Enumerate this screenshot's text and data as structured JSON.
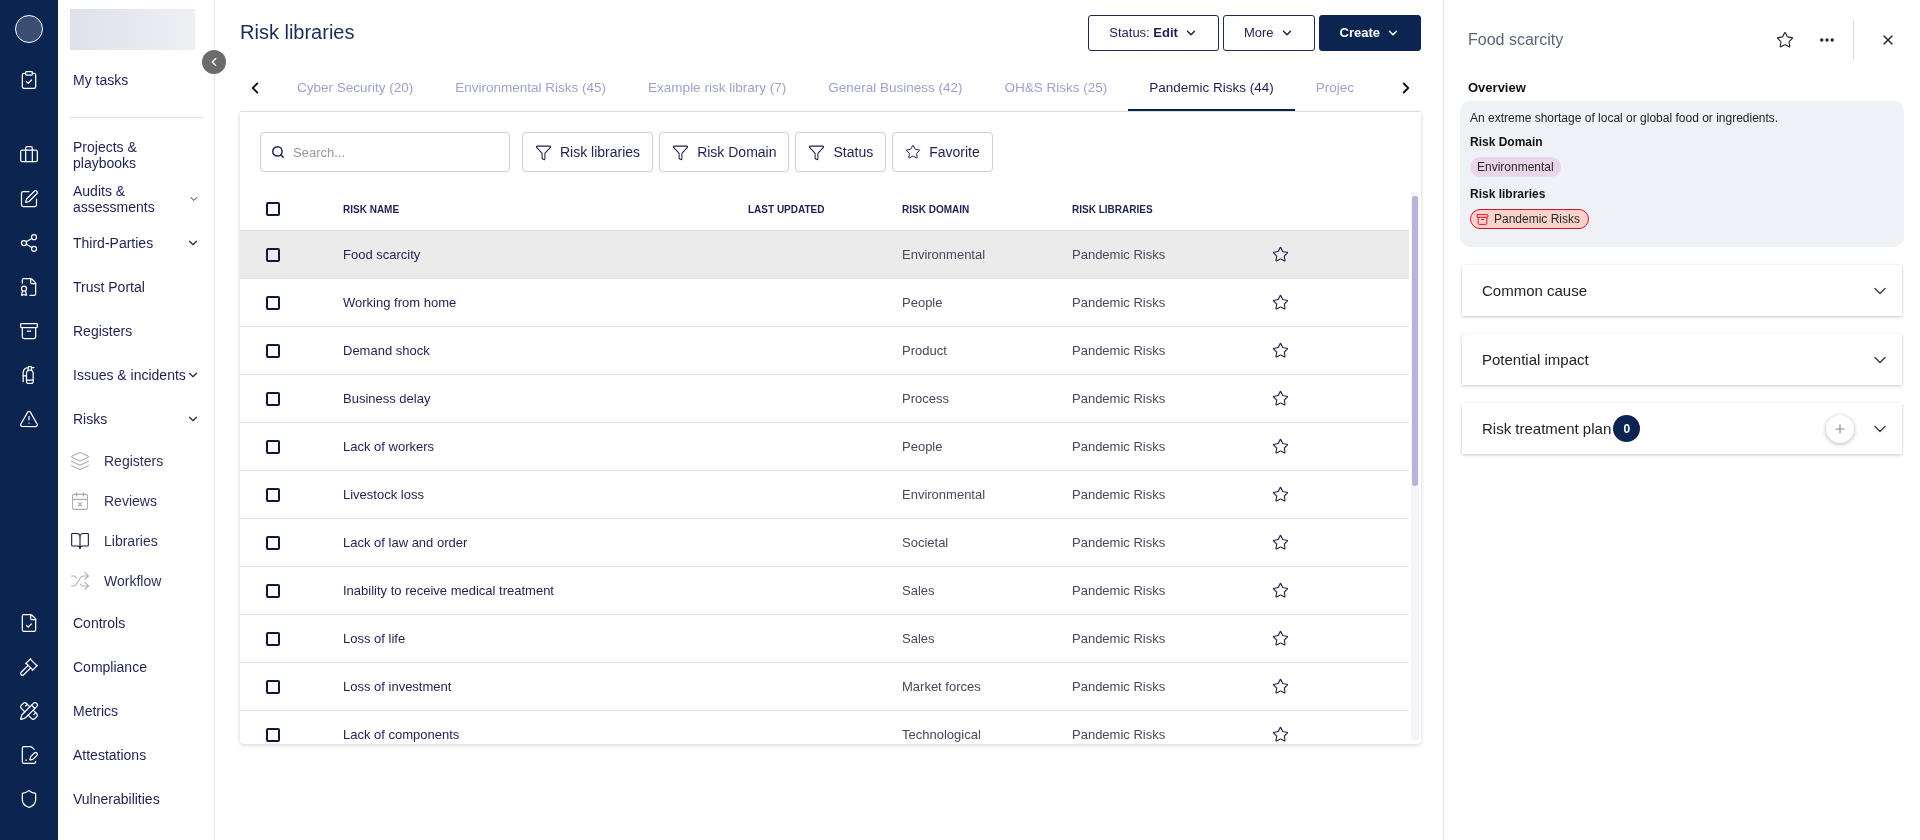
{
  "nav": {
    "top_items": [
      {
        "label": "My tasks"
      }
    ],
    "items": [
      {
        "label": "Projects & playbooks",
        "has_menu": false
      },
      {
        "label": "Audits & assessments",
        "has_menu": true
      },
      {
        "label": "Third-Parties",
        "has_menu": true
      },
      {
        "label": "Trust Portal",
        "has_menu": false
      },
      {
        "label": "Registers",
        "has_menu": false
      },
      {
        "label": "Issues & incidents",
        "has_menu": true
      },
      {
        "label": "Risks",
        "has_menu": true,
        "children": [
          {
            "label": "Registers",
            "selected": false
          },
          {
            "label": "Reviews",
            "selected": false
          },
          {
            "label": "Libraries",
            "selected": true
          },
          {
            "label": "Workflow",
            "selected": false
          }
        ]
      },
      {
        "label": "Controls",
        "has_menu": false
      },
      {
        "label": "Compliance",
        "has_menu": false
      },
      {
        "label": "Metrics",
        "has_menu": false
      },
      {
        "label": "Attestations",
        "has_menu": false
      },
      {
        "label": "Vulnerabilities",
        "has_menu": false
      }
    ]
  },
  "page": {
    "title": "Risk libraries",
    "buttons": [
      {
        "label": "Status: **Edit**",
        "kind": "outline"
      },
      {
        "label": "More",
        "kind": "outline"
      },
      {
        "label": "Create",
        "kind": "primary"
      }
    ]
  },
  "tabs": [
    {
      "label": "Cyber Security (20)",
      "selected": false
    },
    {
      "label": "Environmental Risks (45)",
      "selected": false
    },
    {
      "label": "Example risk library (7)",
      "selected": false
    },
    {
      "label": "General Business (42)",
      "selected": false
    },
    {
      "label": "OH&S Risks (25)",
      "selected": false
    },
    {
      "label": "Pandemic Risks (44)",
      "selected": true
    },
    {
      "label": "Projec",
      "selected": false
    }
  ],
  "search": {
    "placeholder": "Search..."
  },
  "filters": [
    {
      "label": "Risk libraries",
      "kind": "filter"
    },
    {
      "label": "Risk Domain",
      "kind": "filter"
    },
    {
      "label": "Status",
      "kind": "filter"
    },
    {
      "label": "Favorite",
      "kind": "favorite"
    }
  ],
  "table": {
    "columns": [
      "RISK NAME",
      "LAST UPDATED",
      "RISK DOMAIN",
      "RISK LIBRARIES"
    ],
    "all_checked": false,
    "rows": [
      {
        "name": "Food scarcity",
        "domain": "Environmental",
        "library": "Pandemic Risks",
        "selected": true,
        "checked": false,
        "favorite": false
      },
      {
        "name": "Working from home",
        "domain": "People",
        "library": "Pandemic Risks",
        "selected": false,
        "checked": false,
        "favorite": false
      },
      {
        "name": "Demand shock",
        "domain": "Product",
        "library": "Pandemic Risks",
        "selected": false,
        "checked": false,
        "favorite": false
      },
      {
        "name": "Business delay",
        "domain": "Process",
        "library": "Pandemic Risks",
        "selected": false,
        "checked": false,
        "favorite": false
      },
      {
        "name": "Lack of workers",
        "domain": "People",
        "library": "Pandemic Risks",
        "selected": false,
        "checked": false,
        "favorite": false
      },
      {
        "name": "Livestock loss",
        "domain": "Environmental",
        "library": "Pandemic Risks",
        "selected": false,
        "checked": false,
        "favorite": false
      },
      {
        "name": "Lack of law and order",
        "domain": "Societal",
        "library": "Pandemic Risks",
        "selected": false,
        "checked": false,
        "favorite": false
      },
      {
        "name": "Inability to receive medical treatment",
        "domain": "Sales",
        "library": "Pandemic Risks",
        "selected": false,
        "checked": false,
        "favorite": false
      },
      {
        "name": "Loss of life",
        "domain": "Sales",
        "library": "Pandemic Risks",
        "selected": false,
        "checked": false,
        "favorite": false
      },
      {
        "name": "Loss of investment",
        "domain": "Market forces",
        "library": "Pandemic Risks",
        "selected": false,
        "checked": false,
        "favorite": false
      },
      {
        "name": "Lack of components",
        "domain": "Technological",
        "library": "Pandemic Risks",
        "selected": false,
        "checked": false,
        "favorite": false
      }
    ]
  },
  "detail": {
    "title": "Food scarcity",
    "favorite": false,
    "overview_heading": "Overview",
    "description": "An extreme shortage of local or global food or ingredients.",
    "domain_heading": "Risk Domain",
    "domain_tag": "Environmental",
    "libraries_heading": "Risk libraries",
    "library_tags": [
      "Pandemic Risks"
    ],
    "sections": [
      {
        "label": "Common cause",
        "kind": "plain"
      },
      {
        "label": "Potential impact",
        "kind": "plain"
      },
      {
        "label": "Risk treatment plan",
        "kind": "count",
        "count": "0"
      }
    ]
  }
}
